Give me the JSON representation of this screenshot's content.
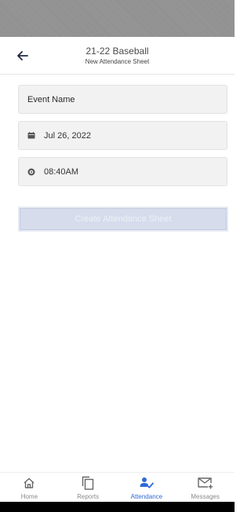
{
  "header": {
    "title": "21-22 Baseball",
    "subtitle": "New Attendance Sheet",
    "back_icon": "arrow-left-icon"
  },
  "form": {
    "event_name_placeholder": "Event Name",
    "date_value": "Jul 26, 2022",
    "date_icon": "calendar-icon",
    "time_value": "08:40AM",
    "time_icon": "clock-icon",
    "create_label": "Create Attendance Sheet"
  },
  "tabs": [
    {
      "label": "Home",
      "icon": "home-icon",
      "active": false
    },
    {
      "label": "Reports",
      "icon": "reports-icon",
      "active": false
    },
    {
      "label": "Attendance",
      "icon": "attendance-icon",
      "active": true
    },
    {
      "label": "Messages",
      "icon": "messages-icon",
      "active": false
    }
  ],
  "colors": {
    "accent": "#2e6ad6",
    "button_disabled": "#d6dcec"
  }
}
